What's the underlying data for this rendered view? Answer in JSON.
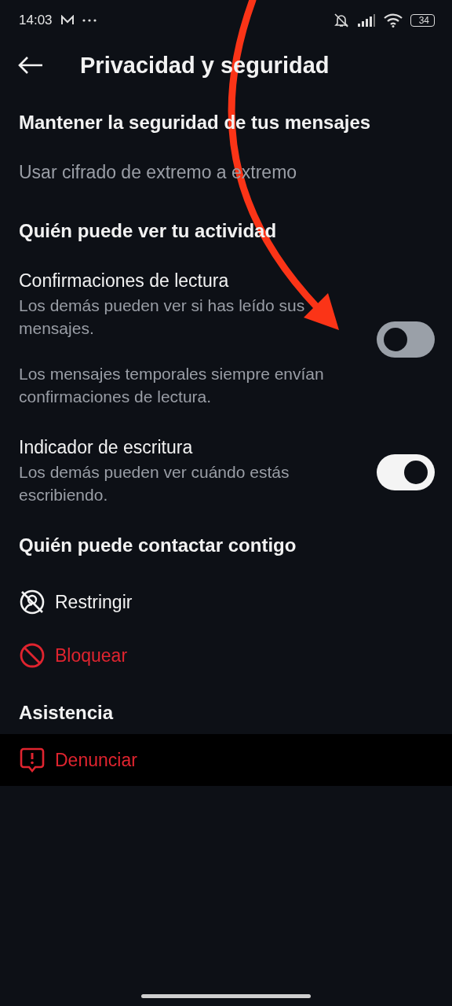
{
  "status_bar": {
    "time": "14:03",
    "battery": "34"
  },
  "header": {
    "title": "Privacidad y seguridad"
  },
  "sections": [
    {
      "title": "Mantener la seguridad de tus mensajes",
      "items": [
        {
          "kind": "link",
          "label": "Usar cifrado de extremo a extremo"
        }
      ]
    },
    {
      "title": "Quién puede ver tu actividad",
      "items": [
        {
          "kind": "toggle",
          "label": "Confirmaciones de lectura",
          "descriptions": [
            "Los demás pueden ver si has leído sus mensajes.",
            "Los mensajes temporales siempre envían confirmaciones de lectura."
          ],
          "on": false
        },
        {
          "kind": "toggle",
          "label": "Indicador de escritura",
          "descriptions": [
            "Los demás pueden ver cuándo estás escribiendo."
          ],
          "on": true
        }
      ]
    },
    {
      "title": "Quién puede contactar contigo",
      "items": [
        {
          "kind": "restrict",
          "label": "Restringir"
        },
        {
          "kind": "block",
          "label": "Bloquear"
        }
      ]
    },
    {
      "title": "Asistencia",
      "items": [
        {
          "kind": "report",
          "label": "Denunciar"
        }
      ]
    }
  ]
}
